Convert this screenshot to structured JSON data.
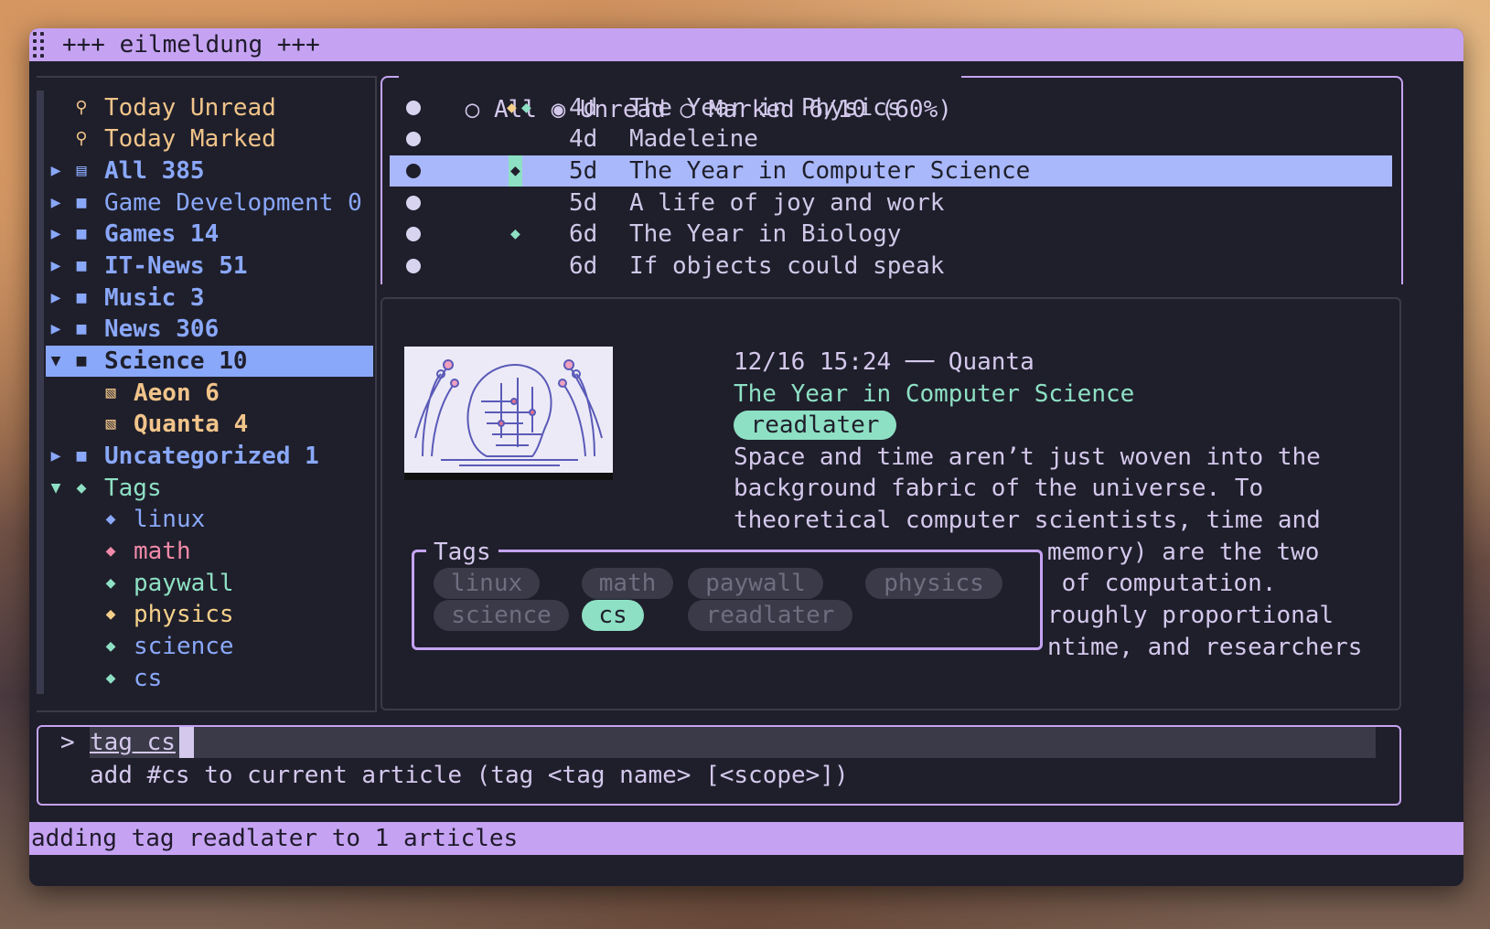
{
  "window": {
    "title": "+++ eilmeldung +++"
  },
  "colors": {
    "accent": "#c5a3f2",
    "selection": "#8aa8fa",
    "tag_green": "#8ee0c4",
    "tag_blue": "#8aa8fa",
    "tag_pink": "#f08aa8",
    "tag_yellow": "#f5d08a",
    "text": "#d4c8ec",
    "feed_text": "#f1c48a"
  },
  "sidebar": {
    "items": [
      {
        "icon": "search-icon",
        "glyph": "⚲",
        "label": "Today Unread"
      },
      {
        "icon": "search-icon",
        "glyph": "⚲",
        "label": "Today Marked"
      },
      {
        "icon": "all-feeds-icon",
        "glyph": "▤",
        "label": "All 385",
        "expander": "▶"
      },
      {
        "icon": "folder-icon",
        "glyph": "■",
        "label": "Game Development 0",
        "expander": "▶"
      },
      {
        "icon": "folder-icon",
        "glyph": "■",
        "label": "Games 14",
        "expander": "▶"
      },
      {
        "icon": "folder-icon",
        "glyph": "■",
        "label": "IT-News 51",
        "expander": "▶"
      },
      {
        "icon": "folder-icon",
        "glyph": "■",
        "label": "Music 3",
        "expander": "▶"
      },
      {
        "icon": "folder-icon",
        "glyph": "■",
        "label": "News 306",
        "expander": "▶"
      },
      {
        "icon": "folder-icon",
        "glyph": "■",
        "label": "Science 10",
        "expander": "▼"
      },
      {
        "icon": "rss-icon",
        "glyph": "▧",
        "label": "Aeon 6"
      },
      {
        "icon": "rss-icon",
        "glyph": "▧",
        "label": "Quanta 4"
      },
      {
        "icon": "folder-icon",
        "glyph": "■",
        "label": "Uncategorized 1",
        "expander": "▶"
      },
      {
        "icon": "tags-icon",
        "glyph": "◆",
        "label": "Tags",
        "expander": "▼"
      },
      {
        "icon": "tag-icon",
        "glyph": "◆",
        "label": "linux"
      },
      {
        "icon": "tag-icon",
        "glyph": "◆",
        "label": "math"
      },
      {
        "icon": "tag-icon",
        "glyph": "◆",
        "label": "paywall"
      },
      {
        "icon": "tag-icon",
        "glyph": "◆",
        "label": "physics"
      },
      {
        "icon": "tag-icon",
        "glyph": "◆",
        "label": "science"
      },
      {
        "icon": "tag-icon",
        "glyph": "◆",
        "label": "cs"
      }
    ]
  },
  "filter": {
    "all": "All",
    "unread": "Unread",
    "marked": "Marked 6/10 (60%)",
    "radio_off": "○",
    "radio_on": "◉"
  },
  "articles": [
    {
      "age": "4d",
      "title": "The Year in Physics"
    },
    {
      "age": "4d",
      "title": "Madeleine"
    },
    {
      "age": "5d",
      "title": "The Year in Computer Science"
    },
    {
      "age": "5d",
      "title": "A life of joy and work"
    },
    {
      "age": "6d",
      "title": "The Year in Biology"
    },
    {
      "age": "6d",
      "title": "If objects could speak"
    }
  ],
  "detail": {
    "datetime": "12/16 15:24 ── Quanta",
    "title": "The Year in Computer Science",
    "tag": "readlater",
    "body": [
      "Space and time aren’t just woven into the",
      "background fabric of the universe. To",
      "theoretical computer scientists, time and",
      "memory) are the two",
      " of computation.",
      "roughly proportional",
      "ntime, and researchers"
    ]
  },
  "tags_popup": {
    "title": "Tags",
    "chips": [
      "linux",
      "math",
      "paywall",
      "physics",
      "science",
      "cs",
      "readlater"
    ]
  },
  "command": {
    "prompt": ">",
    "input": "tag cs",
    "help": "add #cs to current article (tag <tag name> [<scope>])"
  },
  "status": {
    "message": "adding tag readlater to 1 articles"
  }
}
